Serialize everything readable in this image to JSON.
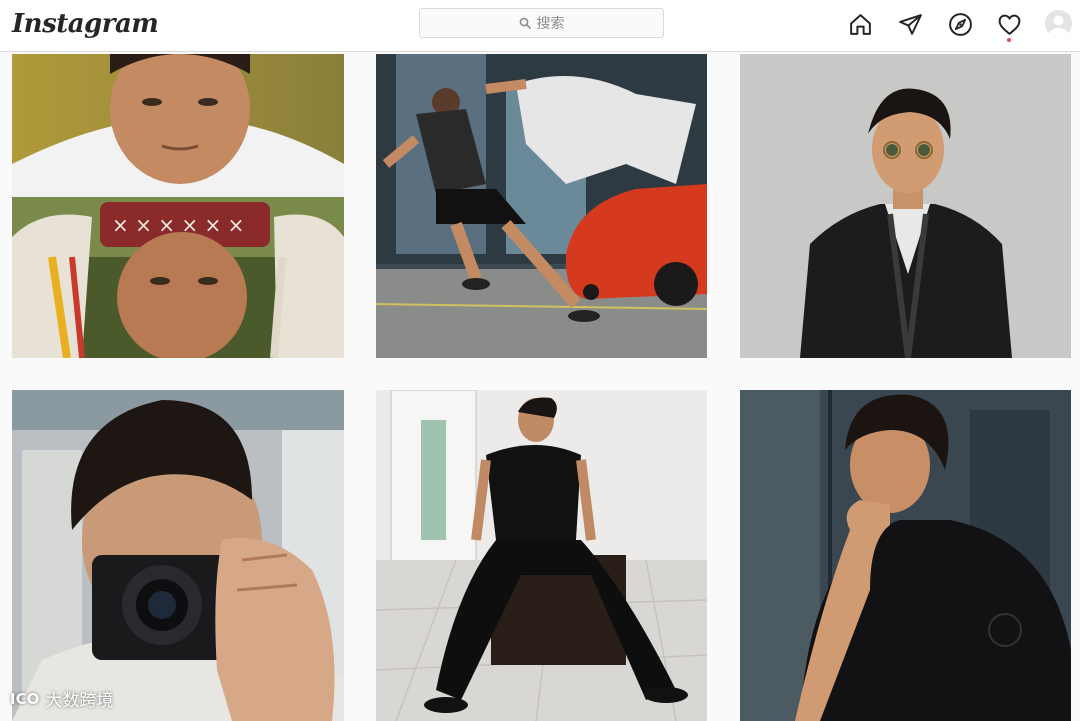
{
  "header": {
    "logo_text": "Instagram",
    "search": {
      "placeholder": "搜索",
      "icon": "search-icon"
    },
    "nav_icons": [
      "home-icon",
      "direct-icon",
      "explore-icon",
      "activity-heart-icon",
      "profile-avatar"
    ]
  },
  "colors": {
    "header_bg": "#ffffff",
    "page_bg": "#fafafa",
    "border": "#dbdbdb",
    "notification_dot": "#ed4956"
  },
  "posts": [
    {
      "id": "post-1",
      "subject": "two-panel film stills"
    },
    {
      "id": "post-2",
      "subject": "man sprinting past red sports car"
    },
    {
      "id": "post-3",
      "subject": "man in sunglasses and leather jacket against wall"
    },
    {
      "id": "post-4",
      "subject": "man holding camera in mirror selfie"
    },
    {
      "id": "post-5",
      "subject": "man in black sitting on cube"
    },
    {
      "id": "post-6",
      "subject": "man in black shirt, hand to chin"
    }
  ],
  "watermark": {
    "logo": "ICO",
    "text": "大数跨境"
  }
}
